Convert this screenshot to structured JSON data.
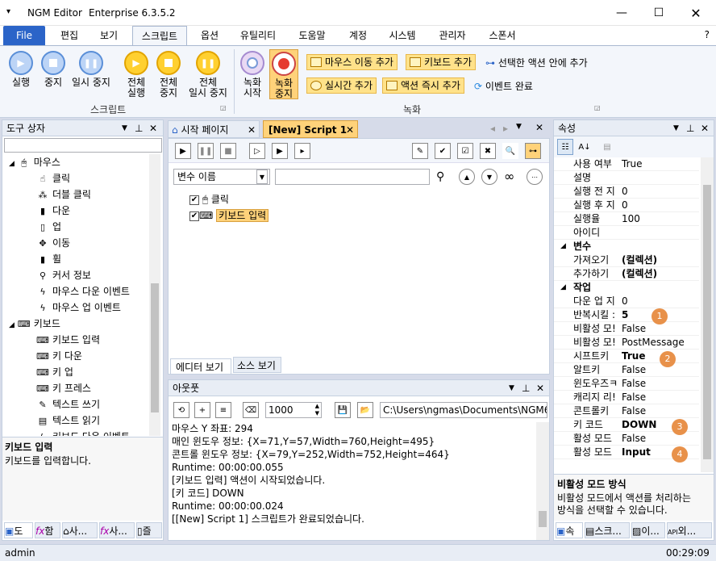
{
  "title": {
    "app": "NGM Editor",
    "edition": "Enterprise 6.3.5.2"
  },
  "menu_tabs": [
    "File",
    "편집",
    "보기",
    "스크립트",
    "옵션",
    "유틸리티",
    "도움말",
    "계정",
    "시스템",
    "관리자",
    "스폰서"
  ],
  "ribbon": {
    "run": "실행",
    "stop": "중지",
    "pause": "일시 중지",
    "run_all": [
      "전체",
      "실행"
    ],
    "stop_all": [
      "전체",
      "중지"
    ],
    "pause_all": [
      "전체",
      "일시 중지"
    ],
    "script_group": "스크립트",
    "rec_start": [
      "녹화",
      "시작"
    ],
    "rec_stop": [
      "녹화",
      "중지"
    ],
    "mouse_move_add": "마우스 이동 추가",
    "keyboard_add": "키보드 추가",
    "add_in_selected": "선택한 액션 안에 추가",
    "realtime_add": "실시간 추가",
    "action_instant_add": "액션 즉시 추가",
    "event_complete": "이벤트 완료",
    "record_group": "녹화"
  },
  "toolbox": {
    "title": "도구 상자",
    "mouse": "마우스",
    "mouse_items": [
      "클릭",
      "더블 클릭",
      "다운",
      "업",
      "이동",
      "휠",
      "커서 정보",
      "마우스 다운 이벤트",
      "마우스 업 이벤트"
    ],
    "keyboard": "키보드",
    "keyboard_items": [
      "키보드 입력",
      "키 다운",
      "키 업",
      "키 프레스",
      "텍스트 쓰기",
      "텍스트 읽기",
      "키보드 다운 이벤트"
    ],
    "desc_title": "키보드 입력",
    "desc_text": "키보드를 입력합니다.",
    "bottom_tabs": [
      "도",
      "함",
      "사...",
      "사...",
      "즐"
    ]
  },
  "doc_tabs": {
    "start": "시작 페이지",
    "script": "[New] Script 1"
  },
  "editor": {
    "var_select": "변수 이름",
    "nodes": [
      "클릭",
      "키보드 입력"
    ],
    "view_editor": "에디터 보기",
    "view_source": "소스 보기"
  },
  "output": {
    "title": "아웃풋",
    "count": "1000",
    "path": "C:\\Users\\ngmas\\Documents\\NGM6\\",
    "lines": [
      "마우스 Y 좌표: 294",
      "매인 윈도우 정보: {X=71,Y=57,Width=760,Height=495}",
      "콘트롤 윈도우 정보: {X=79,Y=252,Width=752,Height=464}",
      "Runtime: 00:00:00.055",
      "[키보드 입력] 액션이 시작되었습니다.",
      "[키 코드] DOWN",
      "Runtime: 00:00:00.024",
      "[[New] Script 1] 스크립트가 완료되었습니다."
    ]
  },
  "properties": {
    "title": "속성",
    "rows1": [
      [
        "사용 여부",
        "True"
      ],
      [
        "설명",
        ""
      ],
      [
        "실행 전 지",
        "0"
      ],
      [
        "실행 후 지",
        "0"
      ],
      [
        "실행율",
        "100"
      ],
      [
        "아이디",
        ""
      ]
    ],
    "cat_var": "변수",
    "rows2": [
      [
        "가져오기",
        "(컬렉션)"
      ],
      [
        "추가하기",
        "(컬렉션)"
      ]
    ],
    "cat_work": "작업",
    "rows3": [
      [
        "다운 업 지",
        "0"
      ],
      [
        "반복시킬 :",
        "5"
      ],
      [
        "비활성 모!",
        "False"
      ],
      [
        "비활성 모!",
        "PostMessage"
      ],
      [
        "시프트키",
        "True"
      ],
      [
        "알트키",
        "False"
      ],
      [
        "윈도우즈ㅋ",
        "False"
      ],
      [
        "캐리지 리!",
        "False"
      ],
      [
        "콘트롤키",
        "False"
      ],
      [
        "키 코드",
        "DOWN"
      ],
      [
        "활성 모드",
        "False"
      ],
      [
        "활성 모드",
        "Input"
      ]
    ],
    "badges": [
      "1",
      "2",
      "3",
      "4"
    ],
    "desc_title": "비활성 모드 방식",
    "desc_text": [
      "비활성 모드에서 액션를 처리하는",
      "방식을 선택할 수 있습니다."
    ],
    "bottom_tabs": [
      "속",
      "스크...",
      "이...",
      "외..."
    ]
  },
  "status": {
    "user": "admin",
    "time": "00:29:09"
  }
}
